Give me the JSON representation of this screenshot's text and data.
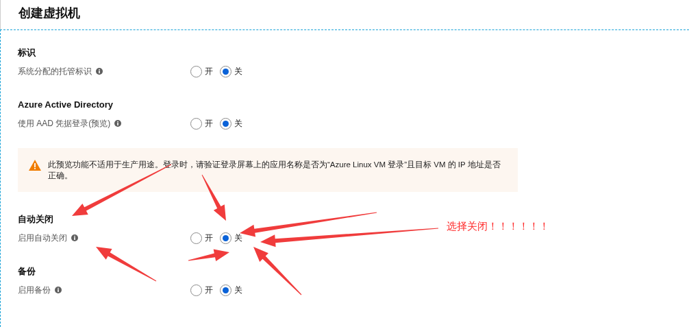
{
  "title": "创建虚拟机",
  "sections": [
    {
      "kind": "setting",
      "heading": "标识",
      "label": "系统分配的托管标识",
      "options": [
        {
          "label": "开",
          "selected": false
        },
        {
          "label": "关",
          "selected": true
        }
      ]
    },
    {
      "kind": "setting",
      "heading": "Azure Active Directory",
      "label": "使用 AAD 凭据登录(预览)",
      "options": [
        {
          "label": "开",
          "selected": false
        },
        {
          "label": "关",
          "selected": true
        }
      ]
    },
    {
      "kind": "warning",
      "text": "此预览功能不适用于生产用途。登录时，请验证登录屏幕上的应用名称是否为“Azure Linux VM 登录”且目标 VM 的 IP 地址是否正确。"
    },
    {
      "kind": "setting",
      "heading": "自动关闭",
      "label": "启用自动关闭",
      "options": [
        {
          "label": "开",
          "selected": false
        },
        {
          "label": "关",
          "selected": true
        }
      ]
    },
    {
      "kind": "setting",
      "heading": "备份",
      "label": "启用备份",
      "options": [
        {
          "label": "开",
          "selected": false
        },
        {
          "label": "关",
          "selected": true
        }
      ]
    }
  ],
  "annotation": "选择关闭！！！！！！"
}
